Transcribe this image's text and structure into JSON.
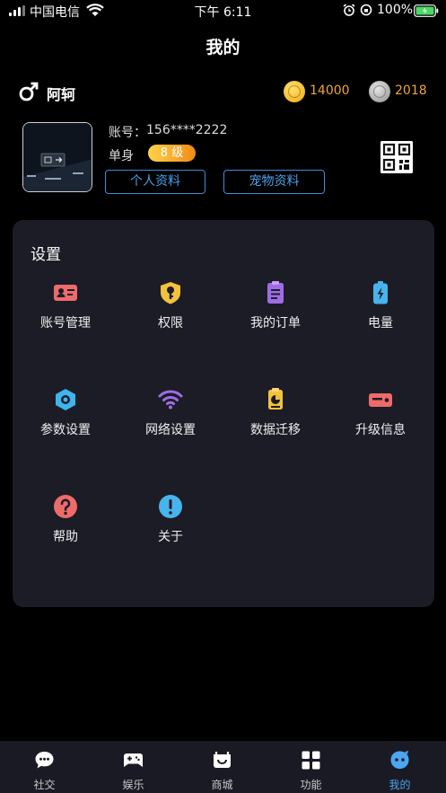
{
  "status_bar": {
    "carrier": "中国电信",
    "time": "下午 6:11",
    "battery": "100%"
  },
  "header": {
    "title": "我的"
  },
  "user": {
    "name": "阿轲",
    "gold_coins": "14000",
    "silver_coins": "2018",
    "account_label": "账号：",
    "account_value": "156****2222",
    "relationship": "单身",
    "level": "8 级",
    "personal_info_label": "个人资料",
    "pet_info_label": "宠物资料"
  },
  "settings": {
    "title": "设置",
    "items": [
      {
        "label": "账号管理",
        "icon": "id-card-icon",
        "color": "#ee6b6b"
      },
      {
        "label": "权限",
        "icon": "key-shield-icon",
        "color": "#f3c23c"
      },
      {
        "label": "我的订单",
        "icon": "clipboard-icon",
        "color": "#9f6ce6"
      },
      {
        "label": "电量",
        "icon": "battery-charge-icon",
        "color": "#48b4ec"
      },
      {
        "label": "参数设置",
        "icon": "hex-settings-icon",
        "color": "#3fb4ec"
      },
      {
        "label": "网络设置",
        "icon": "wifi-icon",
        "color": "#9f6ce6"
      },
      {
        "label": "数据迁移",
        "icon": "data-transfer-icon",
        "color": "#f3c23c"
      },
      {
        "label": "升级信息",
        "icon": "upgrade-info-icon",
        "color": "#ee6b6b"
      },
      {
        "label": "帮助",
        "icon": "help-icon",
        "color": "#ee6b6b"
      },
      {
        "label": "关于",
        "icon": "about-icon",
        "color": "#48b4ec"
      }
    ]
  },
  "tabs": [
    {
      "label": "社交",
      "icon": "chat-bubble-icon"
    },
    {
      "label": "娱乐",
      "icon": "gamepad-icon"
    },
    {
      "label": "商城",
      "icon": "store-icon"
    },
    {
      "label": "功能",
      "icon": "grid-icon"
    },
    {
      "label": "我的",
      "icon": "profile-face-icon",
      "active": true
    }
  ],
  "colors": {
    "accent": "#4aa6f0",
    "coin_text": "#f0a43a",
    "panel_bg": "#1c1c26"
  }
}
